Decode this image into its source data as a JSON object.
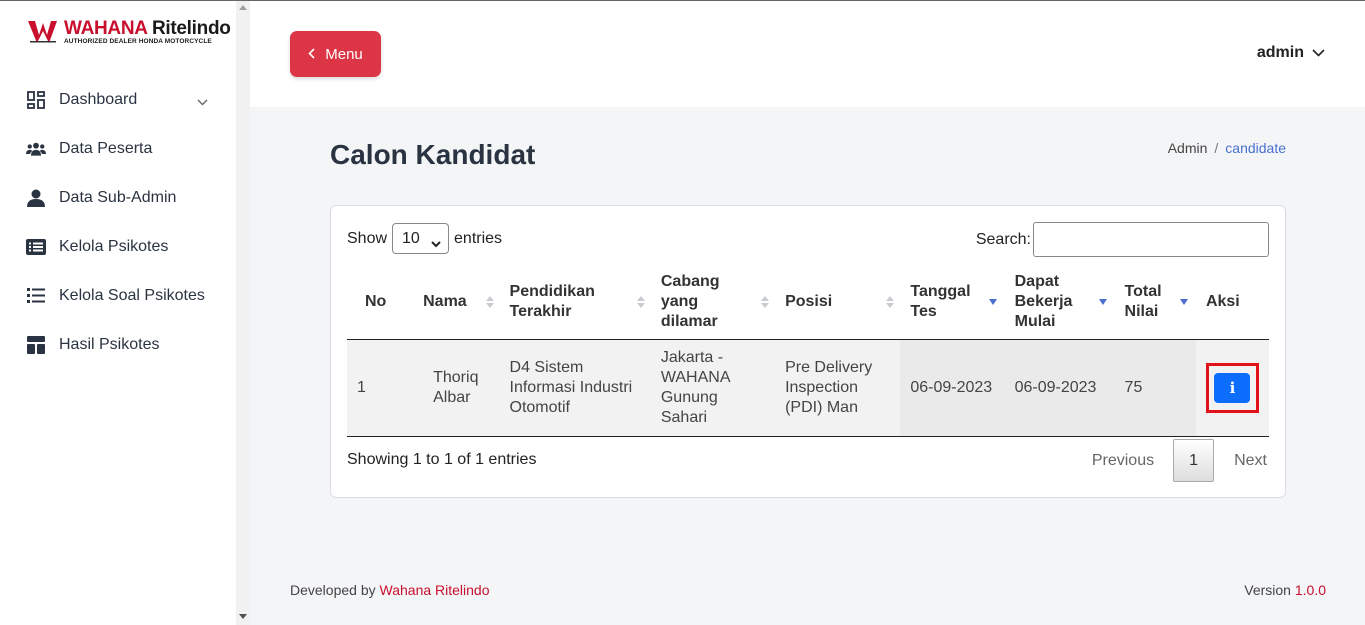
{
  "brand": {
    "name_part1": "WAHANA",
    "name_part2": "Ritelindo",
    "tagline": "AUTHORIZED DEALER HONDA MOTORCYCLE",
    "accent_color": "#c8102e"
  },
  "sidebar": {
    "items": [
      {
        "label": "Dashboard",
        "icon": "grid-icon"
      },
      {
        "label": "Data Peserta",
        "icon": "users-icon"
      },
      {
        "label": "Data Sub-Admin",
        "icon": "user-icon"
      },
      {
        "label": "Kelola Psikotes",
        "icon": "list-card-icon"
      },
      {
        "label": "Kelola Soal Psikotes",
        "icon": "list-icon"
      },
      {
        "label": "Hasil Psikotes",
        "icon": "layout-icon"
      }
    ]
  },
  "header": {
    "menu_label": "Menu",
    "user_label": "admin"
  },
  "page": {
    "title": "Calon Kandidat",
    "breadcrumb": [
      "Admin",
      "candidate"
    ]
  },
  "table_controls": {
    "show_label": "Show",
    "entries_label": "entries",
    "page_size": "10",
    "search_label": "Search:"
  },
  "table": {
    "headers": [
      "No",
      "Nama",
      "Pendidikan Terakhir",
      "Cabang yang dilamar",
      "Posisi",
      "Tanggal Tes",
      "Dapat Bekerja Mulai",
      "Total Nilai",
      "Aksi"
    ],
    "rows": [
      {
        "no": "1",
        "nama": "Thoriq Albar",
        "pendidikan": "D4 Sistem Informasi Industri Otomotif",
        "cabang": "Jakarta - WAHANA Gunung Sahari",
        "posisi": "Pre Delivery Inspection (PDI) Man",
        "tanggal_tes": "06-09-2023",
        "mulai": "06-09-2023",
        "nilai": "75",
        "aksi_icon": "i"
      }
    ]
  },
  "pagination": {
    "summary": "Showing 1 to 1 of 1 entries",
    "previous": "Previous",
    "current": "1",
    "next": "Next"
  },
  "footer": {
    "developed_by": "Developed by",
    "company": "Wahana Ritelindo",
    "version_label": "Version",
    "version": "1.0.0"
  }
}
